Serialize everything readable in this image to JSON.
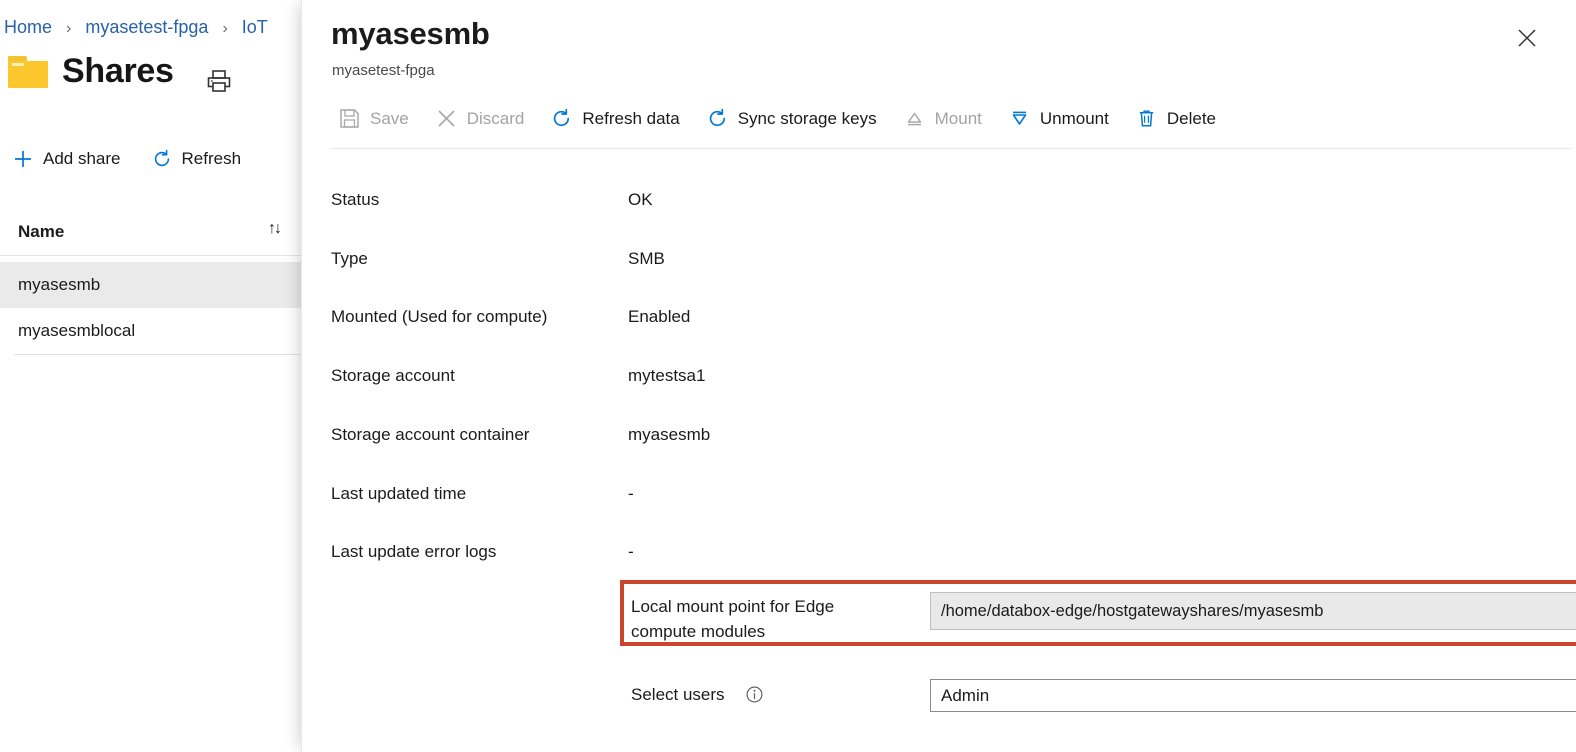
{
  "breadcrumb": {
    "items": [
      {
        "label": "Home"
      },
      {
        "label": "myasetest-fpga"
      },
      {
        "label": "IoT"
      }
    ],
    "separator": "›"
  },
  "page": {
    "title": "Shares",
    "folder_icon": "folder-icon",
    "print_icon": "print-icon"
  },
  "command_bar": {
    "add_share": {
      "label": "Add share",
      "icon": "plus-icon"
    },
    "refresh": {
      "label": "Refresh",
      "icon": "refresh-icon"
    }
  },
  "list": {
    "column_header": "Name",
    "sort_icon": "↑↓",
    "rows": [
      {
        "name": "myasesmb",
        "selected": true
      },
      {
        "name": "myasesmblocal",
        "selected": false
      }
    ]
  },
  "panel": {
    "title": "myasesmb",
    "subtitle": "myasetest-fpga",
    "close_icon": "close-icon",
    "toolbar": [
      {
        "label": "Save",
        "icon": "save-icon",
        "enabled": false
      },
      {
        "label": "Discard",
        "icon": "discard-icon",
        "enabled": false
      },
      {
        "label": "Refresh data",
        "icon": "refresh-icon",
        "enabled": true
      },
      {
        "label": "Sync storage keys",
        "icon": "sync-icon",
        "enabled": true
      },
      {
        "label": "Mount",
        "icon": "mount-icon",
        "enabled": false
      },
      {
        "label": "Unmount",
        "icon": "unmount-icon",
        "enabled": true
      },
      {
        "label": "Delete",
        "icon": "delete-icon",
        "enabled": true
      }
    ],
    "fields": [
      {
        "label": "Status",
        "value": "OK"
      },
      {
        "label": "Type",
        "value": "SMB"
      },
      {
        "label": "Mounted (Used for compute)",
        "value": "Enabled"
      },
      {
        "label": "Storage account",
        "value": "mytestsa1"
      },
      {
        "label": "Storage account container",
        "value": "myasesmb"
      },
      {
        "label": "Last updated time",
        "value": "-"
      },
      {
        "label": "Last update error logs",
        "value": "-"
      }
    ],
    "mount_point": {
      "label": "Local mount point for Edge compute modules",
      "value": "/home/databox-edge/hostgatewayshares/myasesmb",
      "copy_icon": "copy-icon",
      "highlight_color": "#c9452c"
    },
    "select_users": {
      "label": "Select users",
      "info_icon": "info-icon",
      "value": "Admin",
      "chevron_icon": "chevron-down-icon"
    }
  },
  "colors": {
    "accent": "#0078d4",
    "link": "#2862a8",
    "highlight": "#c9452c",
    "selected_row": "#eaeaea",
    "folder": "#fbc72c"
  }
}
